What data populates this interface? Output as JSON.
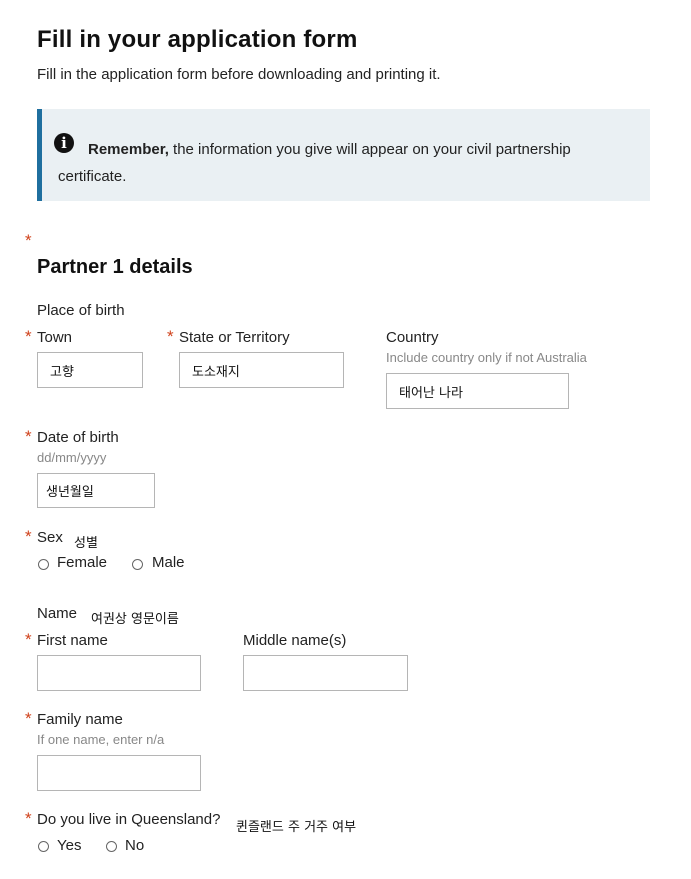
{
  "page": {
    "title": "Fill in your application form",
    "intro": "Fill in the application form before downloading and printing it."
  },
  "callout": {
    "icon": "info-icon",
    "bold": "Remember,",
    "text": " the information you give will appear on your civil partnership certificate."
  },
  "required_marker": "*",
  "section": {
    "title": "Partner 1 details"
  },
  "place_of_birth": {
    "label": "Place of birth",
    "town": {
      "label": "Town",
      "value": "고향"
    },
    "state": {
      "label": "State or Territory",
      "value": "도소재지"
    },
    "country": {
      "label": "Country",
      "hint": "Include country only if not Australia",
      "value": "태어난 나라"
    }
  },
  "dob": {
    "label": "Date of birth",
    "hint": "dd/mm/yyyy",
    "value": "생년월일"
  },
  "sex": {
    "label": "Sex",
    "note": "성별",
    "options": [
      "Female",
      "Male"
    ],
    "selected": null
  },
  "name": {
    "label": "Name",
    "note": "여권상 영문이름",
    "first": {
      "label": "First name",
      "value": ""
    },
    "middle": {
      "label": "Middle name(s)",
      "value": ""
    },
    "family": {
      "label": "Family name",
      "hint": "If one name, enter n/a",
      "value": ""
    }
  },
  "queensland": {
    "label": "Do you live in Queensland?",
    "note": "퀸즐랜드 주 거주 여부",
    "options": [
      "Yes",
      "No"
    ],
    "selected": null
  }
}
